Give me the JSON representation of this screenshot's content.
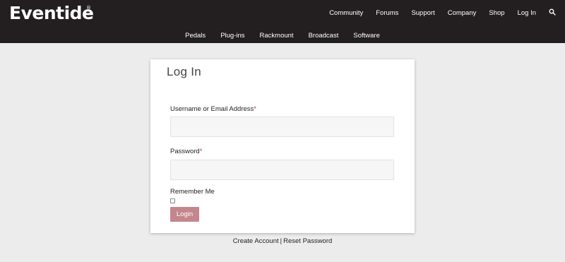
{
  "brand": {
    "name": "Eventide",
    "reg_mark": "®"
  },
  "top_nav": [
    "Community",
    "Forums",
    "Support",
    "Company",
    "Shop",
    "Log In"
  ],
  "sub_nav": [
    "Pedals",
    "Plug-ins",
    "Rackmount",
    "Broadcast",
    "Software"
  ],
  "form": {
    "title": "Log In",
    "username_label": "Username or Email Address",
    "username_value": "",
    "password_label": "Password",
    "password_value": "",
    "required_mark": "*",
    "remember_label": "Remember Me",
    "remember_checked": false,
    "submit_label": "Login"
  },
  "footer": {
    "create_account": "Create Account",
    "separator": "|",
    "reset_password": "Reset Password"
  },
  "colors": {
    "header_bg": "#231f20",
    "page_bg": "#ececec",
    "button_bg": "#c4868c",
    "required": "#c0392b"
  },
  "icons": {
    "search": "search-icon"
  }
}
